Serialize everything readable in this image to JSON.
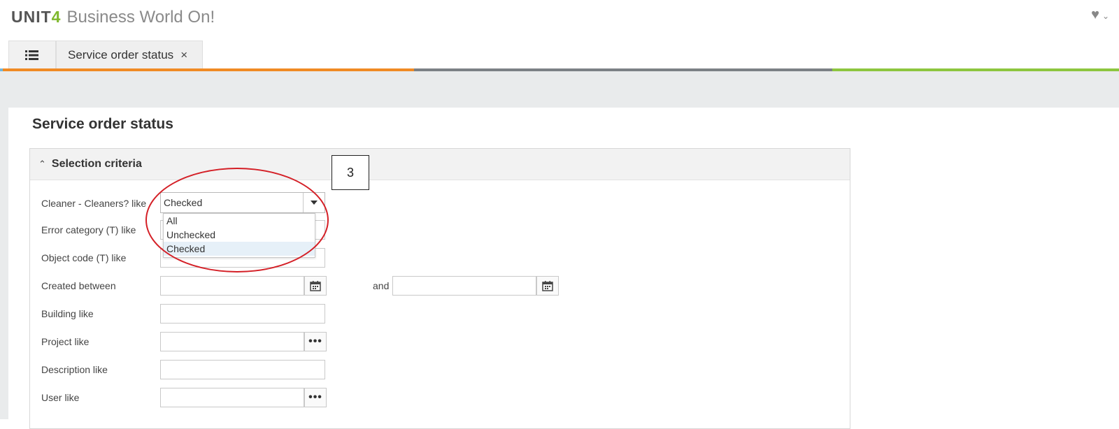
{
  "header": {
    "logo_unit": "UNIT",
    "logo_four": "4",
    "product": "Business World On!",
    "favorite_icon": "heart-icon",
    "favorite_chevron": "chevron-down-icon"
  },
  "tabs": {
    "menu_icon": "list-icon",
    "active_title": "Service order status",
    "close_glyph": "×"
  },
  "colors": {
    "accent_orange": "#f08a24",
    "accent_grey": "#7c8085",
    "accent_green": "#8dc63f",
    "accent_blue": "#6fb7e0",
    "highlight_red": "#d41f26"
  },
  "page": {
    "title": "Service order status"
  },
  "panel": {
    "title": "Selection criteria",
    "fields": {
      "cleaner_label": "Cleaner - Cleaners? like",
      "cleaner_value": "Checked",
      "cleaner_options": [
        "All",
        "Unchecked",
        "Checked"
      ],
      "error_label": "Error category (T) like",
      "object_label": "Object code (T) like",
      "created_label": "Created between",
      "created_and": "and",
      "building_label": "Building like",
      "project_label": "Project like",
      "description_label": "Description like",
      "user_label": "User like"
    }
  },
  "annotation": {
    "callout_number": "3"
  }
}
